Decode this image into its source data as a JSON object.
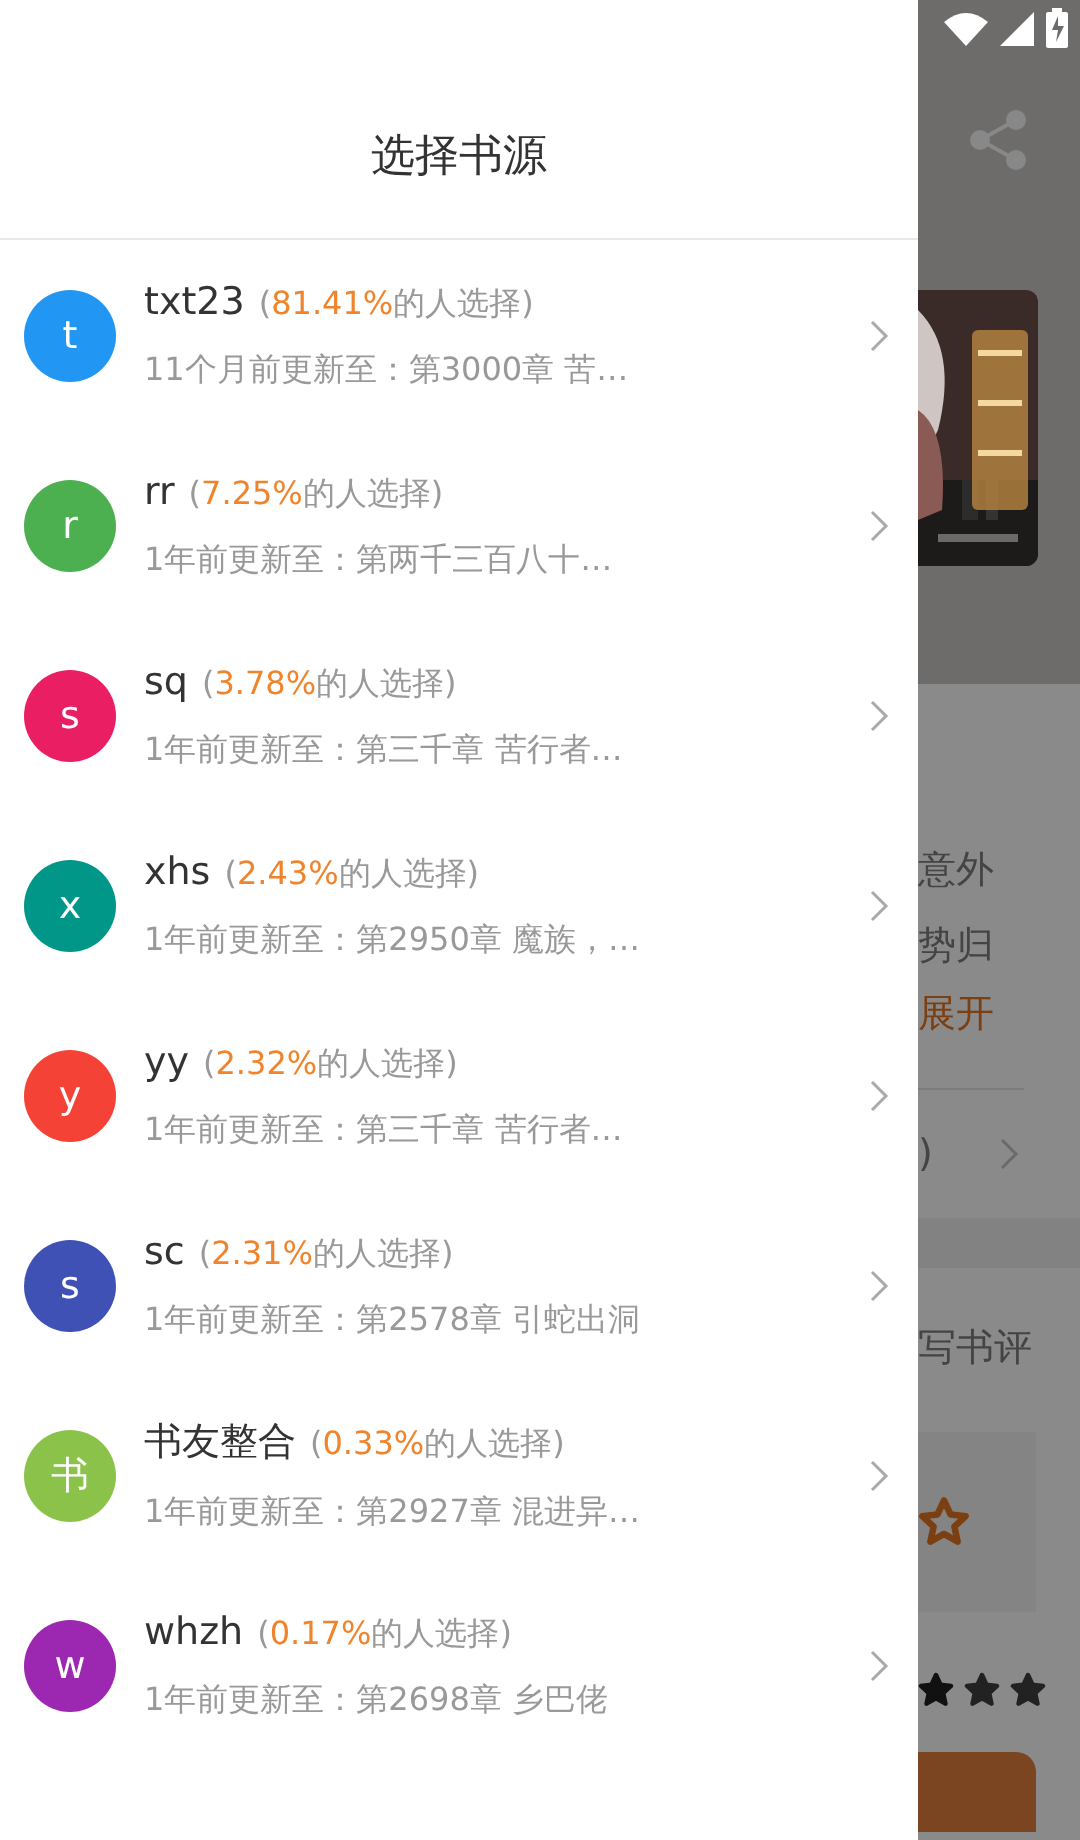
{
  "drawer": {
    "title": "选择书源",
    "sources": [
      {
        "avatar": "t",
        "color": "#2196f3",
        "name": "txt23",
        "share_open": "(",
        "percent": "81.41%",
        "share_rest": "的人选择)",
        "update": "11个月前更新至：第3000章 苦…"
      },
      {
        "avatar": "r",
        "color": "#4caf50",
        "name": "rr",
        "share_open": "(",
        "percent": "7.25%",
        "share_rest": "的人选择)",
        "update": "1年前更新至：第两千三百八十…"
      },
      {
        "avatar": "s",
        "color": "#e91e63",
        "name": "sq",
        "share_open": "(",
        "percent": "3.78%",
        "share_rest": "的人选择)",
        "update": "1年前更新至：第三千章 苦行者…"
      },
      {
        "avatar": "x",
        "color": "#009688",
        "name": "xhs",
        "share_open": "(",
        "percent": "2.43%",
        "share_rest": "的人选择)",
        "update": "1年前更新至：第2950章 魔族，…"
      },
      {
        "avatar": "y",
        "color": "#f44336",
        "name": "yy",
        "share_open": "(",
        "percent": "2.32%",
        "share_rest": "的人选择)",
        "update": "1年前更新至：第三千章 苦行者…"
      },
      {
        "avatar": "s",
        "color": "#3f51b5",
        "name": "sc",
        "share_open": "(",
        "percent": "2.31%",
        "share_rest": "的人选择)",
        "update": "1年前更新至：第2578章 引蛇出洞"
      },
      {
        "avatar": "书",
        "color": "#8bc34a",
        "name": "书友整合",
        "share_open": "(",
        "percent": "0.33%",
        "share_rest": "的人选择)",
        "update": "1年前更新至：第2927章 混进异…"
      },
      {
        "avatar": "w",
        "color": "#9c27b0",
        "name": "whzh",
        "share_open": "(",
        "percent": "0.17%",
        "share_rest": "的人选择)",
        "update": "1年前更新至：第2698章 乡巴佬"
      }
    ]
  },
  "background": {
    "intro_lines": [
      "意外",
      "势归"
    ],
    "expand": "展开",
    "row_end": ")",
    "review": "写书评"
  }
}
